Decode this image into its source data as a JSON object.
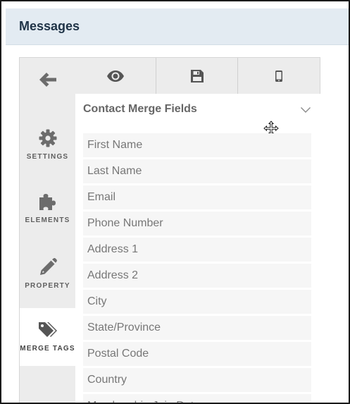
{
  "header": {
    "title": "Messages"
  },
  "nav": {
    "back": {
      "icon": "arrow-left-icon"
    },
    "settings": {
      "icon": "gear-icon",
      "label": "SETTINGS"
    },
    "elements": {
      "icon": "puzzle-icon",
      "label": "ELEMENTS"
    },
    "property": {
      "icon": "pencil-icon",
      "label": "PROPERTY"
    },
    "merge_tags": {
      "icon": "tags-icon",
      "label": "MERGE TAGS",
      "active": true
    }
  },
  "toolbar": {
    "preview": {
      "icon": "eye-icon"
    },
    "save": {
      "icon": "floppy-disk-icon"
    },
    "mobile": {
      "icon": "mobile-phone-icon"
    }
  },
  "panel": {
    "title": "Contact Merge Fields",
    "fields": [
      "First Name",
      "Last Name",
      "Email",
      "Phone Number",
      "Address 1",
      "Address 2",
      "City",
      "State/Province",
      "Postal Code",
      "Country",
      "Membership Join Date"
    ]
  },
  "colors": {
    "header_bg": "#e3ebf2",
    "header_text": "#1f3347",
    "nav_bg": "#ececec",
    "icon": "#6c6c6c",
    "field_bg": "#f6f6f6",
    "field_text": "#777777"
  }
}
